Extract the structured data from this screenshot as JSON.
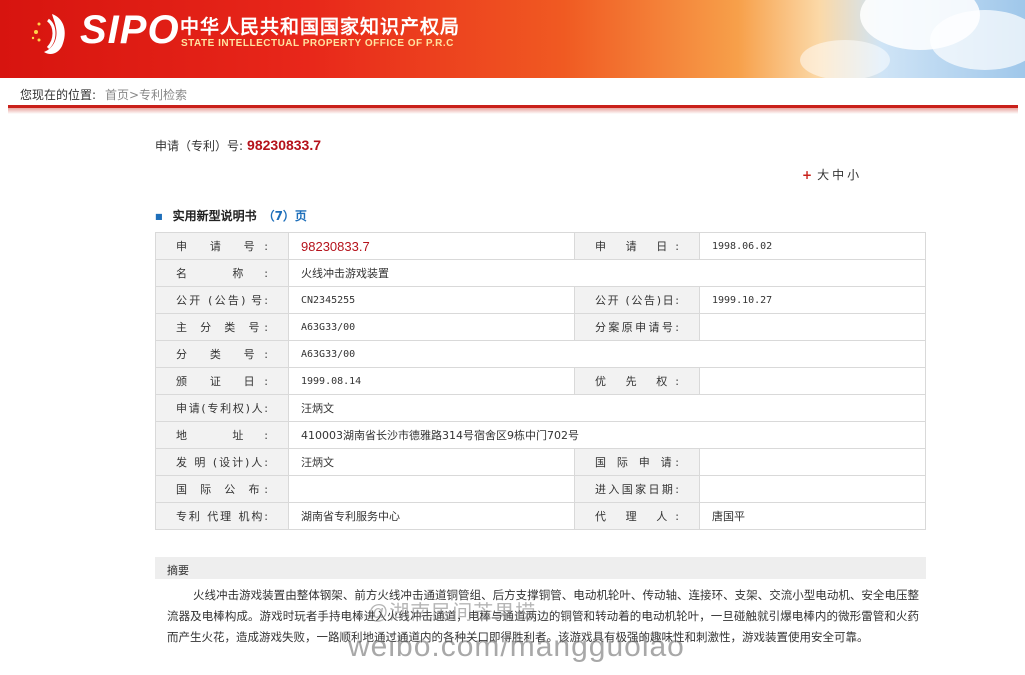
{
  "header": {
    "logo_sipo": "SIPO",
    "logo_cn": "中华人民共和国国家知识产权局",
    "logo_en": "STATE INTELLECTUAL PROPERTY OFFICE OF P.R.C"
  },
  "breadcrumb": {
    "label": "您现在的位置:",
    "path": "首页>专利检索"
  },
  "application": {
    "label": "申请（专利）号:",
    "number": "98230833.7"
  },
  "font_size_control": {
    "plus": "+",
    "options": [
      "大",
      "中",
      "小"
    ]
  },
  "section": {
    "title": "实用新型说明书",
    "pages": "（7）页"
  },
  "table": {
    "rows": [
      {
        "l1": "申 请 号:",
        "v1": "98230833.7",
        "l2": "申 请 日:",
        "v2": "1998.06.02"
      },
      {
        "l1": "名 称:",
        "v1": "火线冲击游戏装置"
      },
      {
        "l1": "公开 (公告) 号:",
        "v1": "CN2345255",
        "l2": "公开 (公告)日:",
        "v2": "1999.10.27"
      },
      {
        "l1": "主 分 类 号:",
        "v1": "A63G33/00",
        "l2": "分案原申请号:",
        "v2": ""
      },
      {
        "l1": "分 类 号:",
        "v1": "A63G33/00"
      },
      {
        "l1": "颁 证 日:",
        "v1": "1999.08.14",
        "l2": "优 先 权:",
        "v2": ""
      },
      {
        "l1": "申请(专利权)人:",
        "v1": "汪炳文"
      },
      {
        "l1": "地 址:",
        "v1": "410003湖南省长沙市德雅路314号宿舍区9栋中门702号"
      },
      {
        "l1": "发 明 (设计)人:",
        "v1": "汪炳文",
        "l2": "国 际 申 请:",
        "v2": ""
      },
      {
        "l1": "国 际 公 布:",
        "v1": "",
        "l2": "进入国家日期:",
        "v2": ""
      },
      {
        "l1": "专利 代理 机构:",
        "v1": "湖南省专利服务中心",
        "l2": "代 理 人:",
        "v2": "唐国平"
      }
    ]
  },
  "abstract": {
    "title": "摘要",
    "text": "火线冲击游戏装置由整体钢架、前方火线冲击通道铜管组、后方支撑铜管、电动机轮叶、传动轴、连接环、支架、交流小型电动机、安全电压整流器及电棒构成。游戏时玩者手持电棒进入火线冲击通道，电棒与通道两边的铜管和转动着的电动机轮叶，一旦碰触就引爆电棒内的微形雷管和火药而产生火花，造成游戏失败，一路顺利地通过通道内的各种关口即得胜利者。该游戏具有极强的趣味性和刺激性，游戏装置使用安全可靠。"
  },
  "watermark": {
    "line1": "@湖南民间芒果捞",
    "line2": "weibo.com/mangguolao"
  },
  "colors": {
    "brand_red": "#c9201a",
    "number_red": "#b5121b",
    "link_blue": "#1e6fba"
  }
}
